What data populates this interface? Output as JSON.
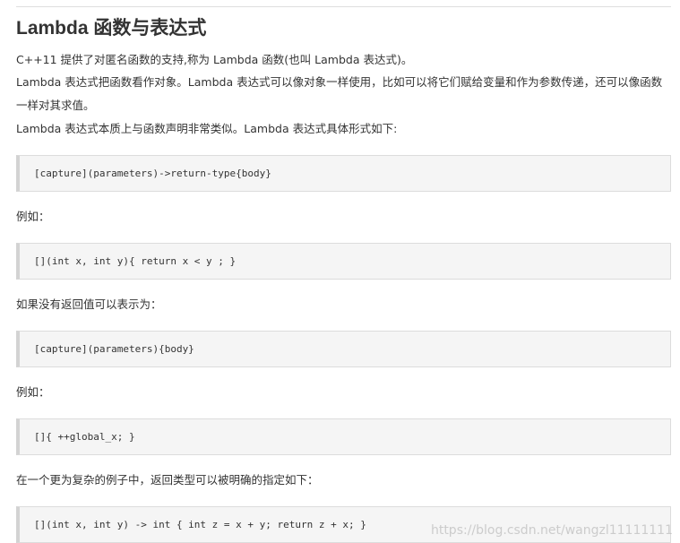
{
  "heading": "Lambda 函数与表达式",
  "paragraphs": {
    "p1": "C++11 提供了对匿名函数的支持,称为 Lambda 函数(也叫 Lambda 表达式)。",
    "p2": "Lambda 表达式把函数看作对象。Lambda 表达式可以像对象一样使用，比如可以将它们赋给变量和作为参数传递，还可以像函数一样对其求值。",
    "p3": "Lambda 表达式本质上与函数声明非常类似。Lambda 表达式具体形式如下:",
    "p4": "例如：",
    "p5": "如果没有返回值可以表示为：",
    "p6": "例如：",
    "p7": "在一个更为复杂的例子中，返回类型可以被明确的指定如下："
  },
  "code": {
    "c1": "[capture](parameters)->return-type{body}",
    "c2": "[](int x, int y){ return x < y ; }",
    "c3": "[capture](parameters){body}",
    "c4": "[]{ ++global_x; }",
    "c5": "[](int x, int y) -> int { int z = x + y; return z + x; }"
  },
  "watermark": "https://blog.csdn.net/wangzl11111111"
}
